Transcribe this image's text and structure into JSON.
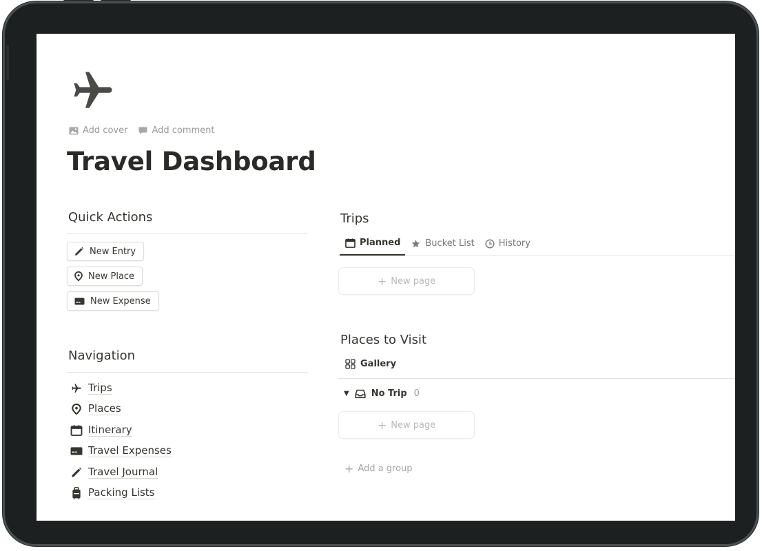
{
  "page": {
    "icon": "airplane-icon",
    "add_cover": "Add cover",
    "add_comment": "Add comment",
    "title": "Travel Dashboard"
  },
  "quick_actions": {
    "heading": "Quick Actions",
    "buttons": [
      {
        "label": "New Entry",
        "icon": "pencil-icon"
      },
      {
        "label": "New Place",
        "icon": "map-pin-icon"
      },
      {
        "label": "New Expense",
        "icon": "credit-card-icon"
      }
    ]
  },
  "navigation": {
    "heading": "Navigation",
    "items": [
      {
        "label": "Trips",
        "icon": "airplane-icon"
      },
      {
        "label": "Places",
        "icon": "map-pin-icon"
      },
      {
        "label": "Itinerary",
        "icon": "calendar-icon"
      },
      {
        "label": "Travel Expenses",
        "icon": "credit-card-icon"
      },
      {
        "label": "Travel Journal",
        "icon": "pencil-icon"
      },
      {
        "label": "Packing Lists",
        "icon": "luggage-icon"
      }
    ]
  },
  "trips": {
    "heading": "Trips",
    "tabs": [
      {
        "label": "Planned",
        "icon": "calendar-icon",
        "active": true
      },
      {
        "label": "Bucket List",
        "icon": "star-icon",
        "active": false
      },
      {
        "label": "History",
        "icon": "clock-icon",
        "active": false
      }
    ],
    "new_page": "New page"
  },
  "places": {
    "heading": "Places to Visit",
    "view": {
      "label": "Gallery",
      "icon": "gallery-icon"
    },
    "group": {
      "label": "No Trip",
      "count": "0",
      "icon": "inbox-icon"
    },
    "new_page": "New page",
    "add_group": "Add a group"
  },
  "colors": {
    "device_bezel": "#1c2021",
    "text": "#37352f",
    "muted": "#9b9a97"
  }
}
